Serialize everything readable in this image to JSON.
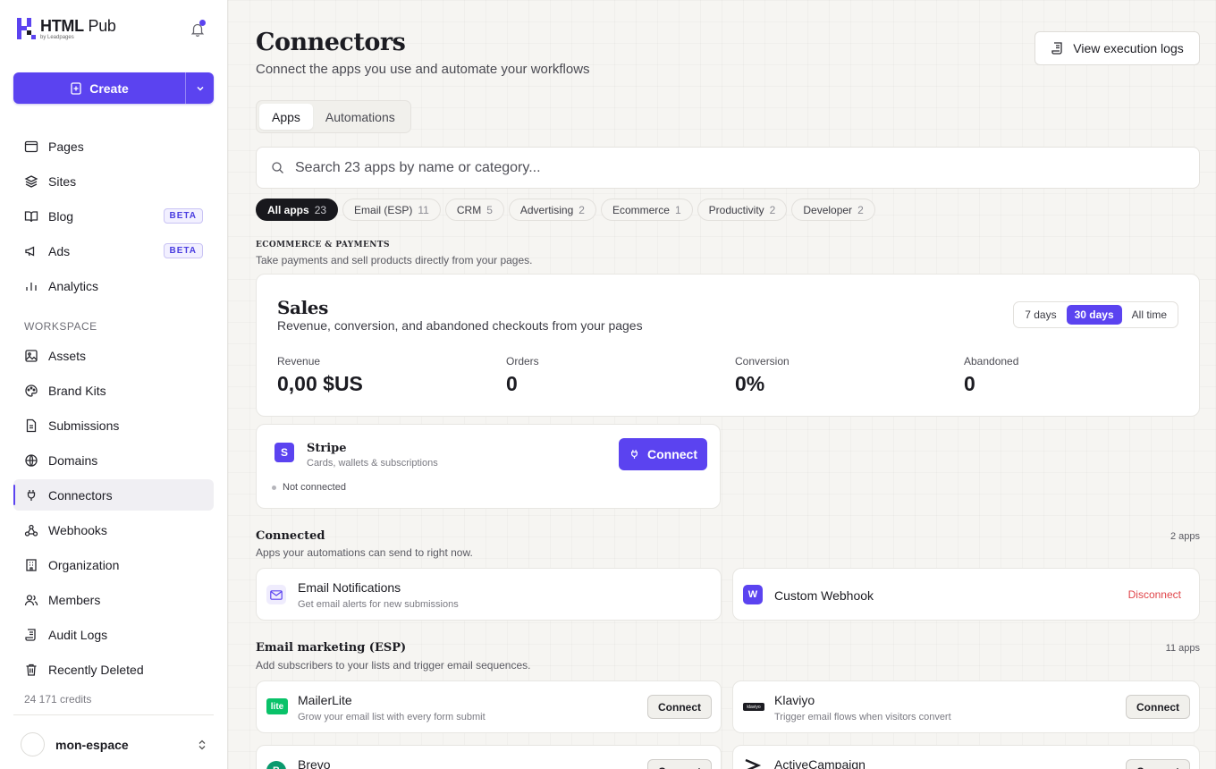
{
  "brand": {
    "name_bold": "HTML",
    "name_light": " Pub",
    "byline": "by Leadpages"
  },
  "sidebar": {
    "create_label": "Create",
    "nav": [
      {
        "label": "Pages",
        "icon": "browser-window-icon"
      },
      {
        "label": "Sites",
        "icon": "layers-icon"
      },
      {
        "label": "Blog",
        "icon": "book-open-icon",
        "badge": "BETA"
      },
      {
        "label": "Ads",
        "icon": "megaphone-icon",
        "badge": "BETA"
      },
      {
        "label": "Analytics",
        "icon": "bar-chart-icon"
      }
    ],
    "workspace_label": "WORKSPACE",
    "workspace_nav": [
      {
        "label": "Assets",
        "icon": "image-icon"
      },
      {
        "label": "Brand Kits",
        "icon": "palette-icon"
      },
      {
        "label": "Submissions",
        "icon": "document-icon"
      },
      {
        "label": "Domains",
        "icon": "globe-icon"
      },
      {
        "label": "Connectors",
        "icon": "plug-icon",
        "active": true
      },
      {
        "label": "Webhooks",
        "icon": "webhook-icon"
      },
      {
        "label": "Organization",
        "icon": "building-icon"
      },
      {
        "label": "Members",
        "icon": "users-icon"
      },
      {
        "label": "Audit Logs",
        "icon": "scroll-icon"
      },
      {
        "label": "Recently Deleted",
        "icon": "trash-icon"
      }
    ],
    "credits": "24 171 credits",
    "workspace_name": "mon-espace"
  },
  "header": {
    "title": "Connectors",
    "subtitle": "Connect the apps you use and automate your workflows",
    "logs_button": "View execution logs"
  },
  "tabs": [
    {
      "label": "Apps",
      "active": true
    },
    {
      "label": "Automations"
    }
  ],
  "search": {
    "placeholder": "Search 23 apps by name or category..."
  },
  "filters": [
    {
      "label": "All apps",
      "count": "23",
      "active": true
    },
    {
      "label": "Email (ESP)",
      "count": "11"
    },
    {
      "label": "CRM",
      "count": "5"
    },
    {
      "label": "Advertising",
      "count": "2"
    },
    {
      "label": "Ecommerce",
      "count": "1"
    },
    {
      "label": "Productivity",
      "count": "2"
    },
    {
      "label": "Developer",
      "count": "2"
    }
  ],
  "ecommerce": {
    "title": "ECOMMERCE & PAYMENTS",
    "subtitle": "Take payments and sell products directly from your pages."
  },
  "sales": {
    "title": "Sales",
    "subtitle": "Revenue, conversion, and abandoned checkouts from your pages",
    "ranges": [
      {
        "label": "7 days"
      },
      {
        "label": "30 days",
        "active": true
      },
      {
        "label": "All time"
      }
    ],
    "metrics": [
      {
        "label": "Revenue",
        "value": "0,00 $US"
      },
      {
        "label": "Orders",
        "value": "0"
      },
      {
        "label": "Conversion",
        "value": "0%"
      },
      {
        "label": "Abandoned",
        "value": "0"
      }
    ]
  },
  "stripe": {
    "name": "Stripe",
    "desc": "Cards, wallets & subscriptions",
    "status": "Not connected",
    "button": "Connect",
    "icon_letter": "S"
  },
  "connected": {
    "title": "Connected",
    "subtitle": "Apps your automations can send to right now.",
    "count": "2 apps",
    "apps": [
      {
        "name": "Email Notifications",
        "desc": "Get email alerts for new submissions"
      },
      {
        "name": "Custom Webhook",
        "action": "Disconnect",
        "icon_letter": "W"
      }
    ]
  },
  "esp": {
    "title": "Email marketing (ESP)",
    "subtitle": "Add subscribers to your lists and trigger email sequences.",
    "count": "11 apps",
    "apps": [
      {
        "name": "MailerLite",
        "desc": "Grow your email list with every form submit",
        "button": "Connect",
        "icon_text": "lite"
      },
      {
        "name": "Klaviyo",
        "desc": "Trigger email flows when visitors convert",
        "button": "Connect",
        "icon_text": "klaviyo"
      },
      {
        "name": "Brevo",
        "button": "Connect",
        "icon_text": "B"
      },
      {
        "name": "ActiveCampaign",
        "button": "Connect"
      }
    ]
  },
  "colors": {
    "accent": "#5b43f0",
    "danger": "#e0454a",
    "mailerlite": "#09c269"
  }
}
